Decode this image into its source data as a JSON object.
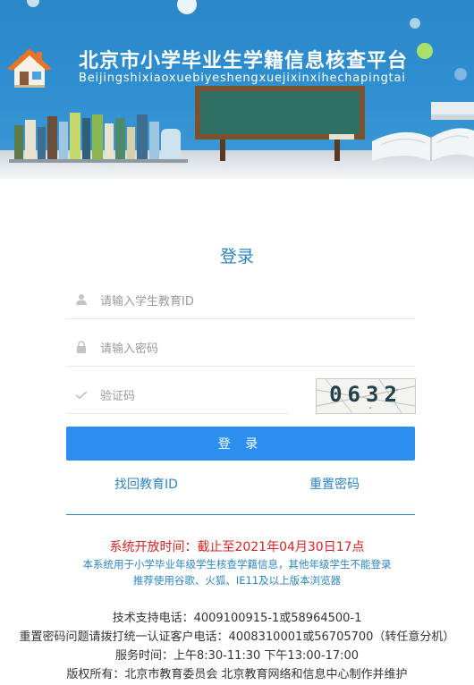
{
  "banner": {
    "title": "北京市小学毕业生学籍信息核查平台",
    "subtitle": "Beijingshixiaoxuebiyeshengxuejixinxihechapingtai"
  },
  "login": {
    "heading": "登录",
    "student_id_placeholder": "请输入学生教育ID",
    "password_placeholder": "请输入密码",
    "captcha_placeholder": "验证码",
    "captcha_code": "0632",
    "submit_label": "登 录",
    "find_id_link": "找回教育ID",
    "reset_password_link": "重置密码"
  },
  "notice": {
    "open_time": "系统开放时间：截止至2021年04月30日17点",
    "line1": "本系统用于小学毕业年级学生核查学籍信息，其他年级学生不能登录",
    "line2": "推荐使用谷歌、火狐、IE11及以上版本浏览器"
  },
  "footer": {
    "tech_support": "技术支持电话：4009100915-1或58964500-1",
    "reset_hotline": "重置密码问题请拨打统一认证客户电话：4008310001或56705700（转任意分机）",
    "service_hours": "服务时间：上午8:30-11:30 下午13:00-17:00",
    "copyright": "版权所有：北京市教育委员会 北京教育网络和信息中心制作并维护"
  },
  "colors": {
    "brand_blue": "#2b86c6",
    "button_blue": "#2b8ff0",
    "notice_red": "#e02020"
  },
  "icons": {
    "user": "user-icon",
    "lock": "lock-icon",
    "check": "check-icon",
    "house": "house-logo-icon"
  }
}
